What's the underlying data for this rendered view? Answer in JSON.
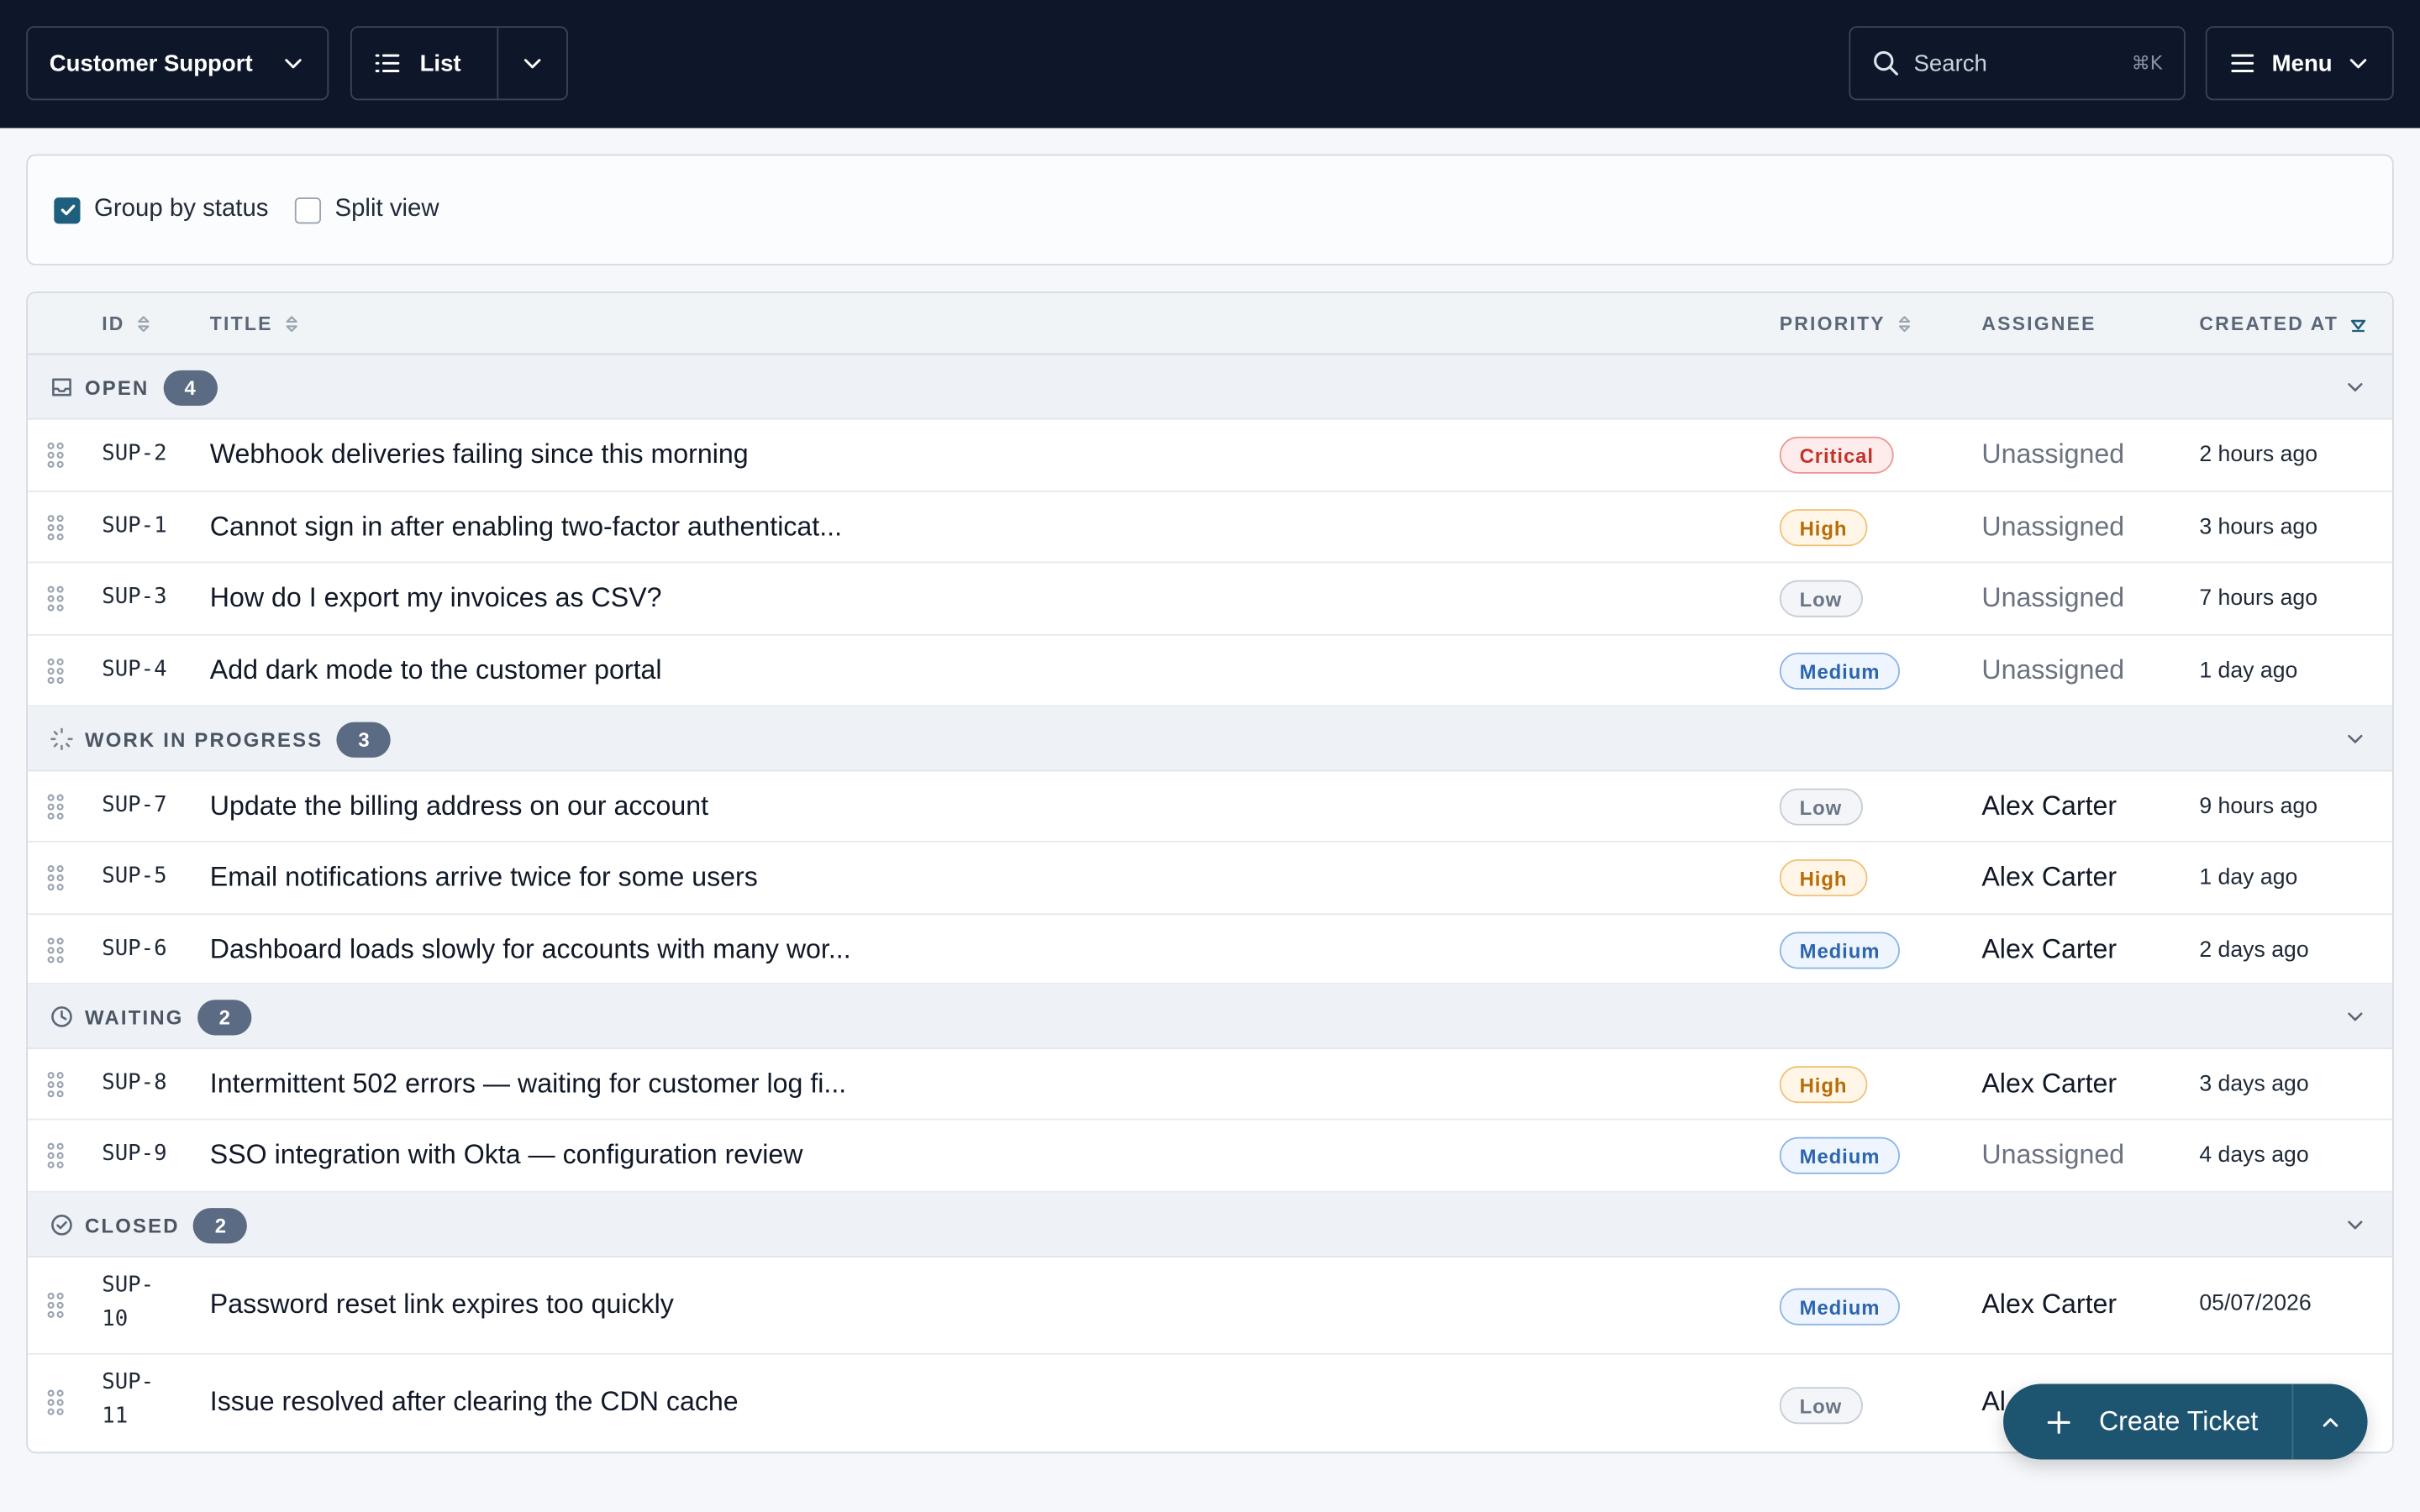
{
  "topbar": {
    "project_label": "Customer Support",
    "view_label": "List",
    "search_placeholder": "Search",
    "search_shortcut": "⌘K",
    "menu_label": "Menu"
  },
  "options": {
    "group_by_status": {
      "label": "Group by status",
      "checked": true
    },
    "split_view": {
      "label": "Split view",
      "checked": false
    }
  },
  "table": {
    "headers": {
      "id": "ID",
      "title": "TITLE",
      "priority": "PRIORITY",
      "assignee": "ASSIGNEE",
      "created_at": "CREATED AT"
    },
    "groups": [
      {
        "label": "OPEN",
        "count": "4",
        "icon": "inbox-icon",
        "rows": [
          {
            "id": "SUP-2",
            "title": "Webhook deliveries failing since this morning",
            "priority": "Critical",
            "assignee": "Unassigned",
            "created": "2 hours ago"
          },
          {
            "id": "SUP-1",
            "title": "Cannot sign in after enabling two-factor authenticat...",
            "priority": "High",
            "assignee": "Unassigned",
            "created": "3 hours ago"
          },
          {
            "id": "SUP-3",
            "title": "How do I export my invoices as CSV?",
            "priority": "Low",
            "assignee": "Unassigned",
            "created": "7 hours ago"
          },
          {
            "id": "SUP-4",
            "title": "Add dark mode to the customer portal",
            "priority": "Medium",
            "assignee": "Unassigned",
            "created": "1 day ago"
          }
        ]
      },
      {
        "label": "WORK IN PROGRESS",
        "count": "3",
        "icon": "spinner-icon",
        "rows": [
          {
            "id": "SUP-7",
            "title": "Update the billing address on our account",
            "priority": "Low",
            "assignee": "Alex Carter",
            "created": "9 hours ago"
          },
          {
            "id": "SUP-5",
            "title": "Email notifications arrive twice for some users",
            "priority": "High",
            "assignee": "Alex Carter",
            "created": "1 day ago"
          },
          {
            "id": "SUP-6",
            "title": "Dashboard loads slowly for accounts with many wor...",
            "priority": "Medium",
            "assignee": "Alex Carter",
            "created": "2 days ago"
          }
        ]
      },
      {
        "label": "WAITING",
        "count": "2",
        "icon": "clock-icon",
        "rows": [
          {
            "id": "SUP-8",
            "title": "Intermittent 502 errors — waiting for customer log fi...",
            "priority": "High",
            "assignee": "Alex Carter",
            "created": "3 days ago"
          },
          {
            "id": "SUP-9",
            "title": "SSO integration with Okta — configuration review",
            "priority": "Medium",
            "assignee": "Unassigned",
            "created": "4 days ago"
          }
        ]
      },
      {
        "label": "CLOSED",
        "count": "2",
        "icon": "check-circle-icon",
        "rows": [
          {
            "id_line1": "SUP-",
            "id_line2": "10",
            "title": "Password reset link expires too quickly",
            "priority": "Medium",
            "assignee": "Alex Carter",
            "created": "05/07/2026"
          },
          {
            "id_line1": "SUP-",
            "id_line2": "11",
            "title": "Issue resolved after clearing the CDN cache",
            "priority": "Low",
            "assignee": "Al",
            "created": ""
          }
        ]
      }
    ]
  },
  "fab": {
    "label": "Create Ticket"
  },
  "colors": {
    "topbar": "#0e1729",
    "accent": "#1f5f7e",
    "fab": "#1d5470",
    "critical": "#c2352b",
    "high": "#b76d06",
    "medium": "#2c65ad",
    "low": "#6b7585"
  }
}
